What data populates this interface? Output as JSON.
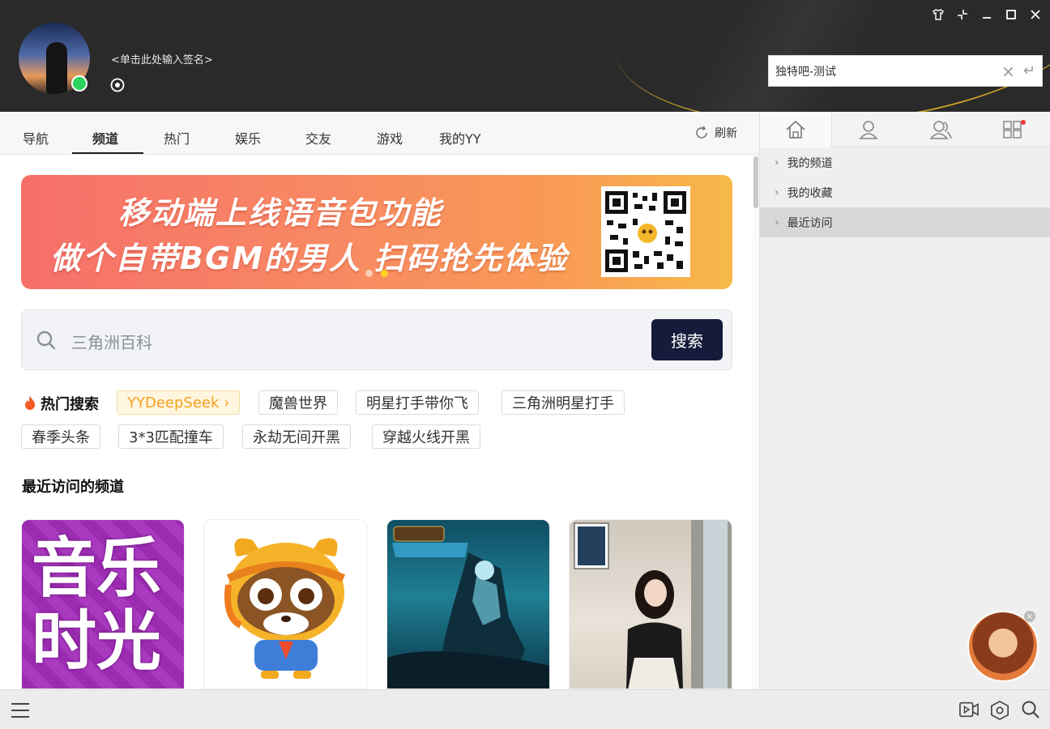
{
  "header": {
    "signature_placeholder": "<单击此处输入签名>",
    "top_search_value": "独特吧-测试",
    "window_controls": [
      "shirt-icon",
      "restore-icon",
      "minimize-icon",
      "maximize-icon",
      "close-icon"
    ]
  },
  "tabs": {
    "items": [
      "导航",
      "频道",
      "热门",
      "娱乐",
      "交友",
      "游戏",
      "我的YY"
    ],
    "active": "频道",
    "refresh_label": "刷新"
  },
  "banner": {
    "line1": "移动端上线语音包功能",
    "line2": "做个自带BGM的男人 扫码抢先体验"
  },
  "search": {
    "placeholder": "三角洲百科",
    "button_label": "搜索"
  },
  "hot_search": {
    "label": "热门搜索",
    "tags": [
      "YYDeepSeek ›",
      "魔兽世界",
      "明星打手带你飞",
      "三角洲明星打手",
      "春季头条",
      "3*3匹配撞车",
      "永劫无间开黑",
      "穿越火线开黑"
    ]
  },
  "recent": {
    "title": "最近访问的频道",
    "card1_text": [
      "音乐",
      "时光"
    ]
  },
  "right_panel": {
    "tabs": [
      "home-icon",
      "user-icon",
      "users-icon",
      "apps-icon"
    ],
    "items": [
      "我的频道",
      "我的收藏",
      "最近访问"
    ]
  },
  "colors": {
    "header_bg": "#2a2a2b",
    "search_button": "#151b3a",
    "hot_tag_text": "#f3a11d",
    "online": "#2bd35c"
  }
}
